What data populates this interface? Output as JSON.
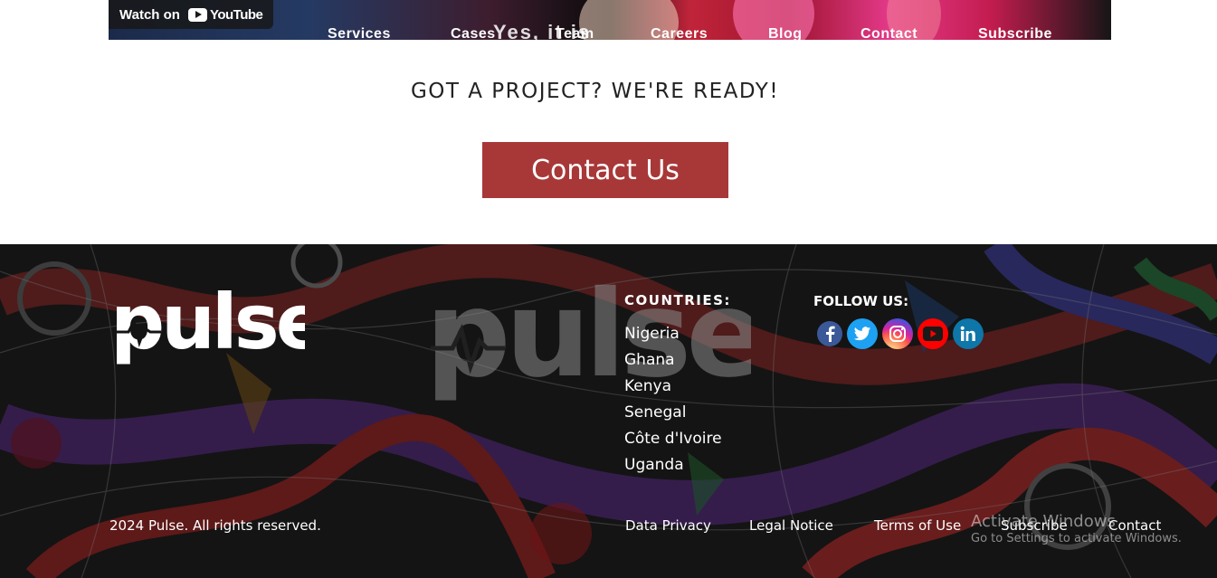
{
  "video": {
    "watch_label": "Watch on",
    "youtube_logo": "YouTube",
    "overlay_text": "Yes, it is",
    "nav": [
      "Services",
      "Cases",
      "Team",
      "Careers",
      "Blog",
      "Contact",
      "Subscribe"
    ]
  },
  "cta": {
    "heading": "GOT A PROJECT? WE'RE READY!",
    "button_label": "Contact Us",
    "button_color": "#a83838"
  },
  "footer": {
    "logo_text": "pulse",
    "countries_title": "COUNTRIES:",
    "countries": [
      "Nigeria",
      "Ghana",
      "Kenya",
      "Senegal",
      "Côte d'Ivoire",
      "Uganda"
    ],
    "follow_title": "FOLLOW US:",
    "socials": [
      {
        "name": "facebook",
        "icon": "facebook-icon",
        "color": "#3b5998"
      },
      {
        "name": "twitter",
        "icon": "twitter-icon",
        "color": "#1da1f2"
      },
      {
        "name": "instagram",
        "icon": "instagram-icon",
        "color": "#c13584"
      },
      {
        "name": "youtube",
        "icon": "youtube-icon",
        "color": "#ff0000"
      },
      {
        "name": "linkedin",
        "icon": "linkedin-icon",
        "color": "#0e76a8"
      }
    ],
    "copyright": "2024 Pulse. All rights reserved.",
    "links": [
      "Data Privacy",
      "Legal Notice",
      "Terms of Use",
      "Subscribe",
      "Contact"
    ]
  },
  "activation": {
    "title": "Activate Windows",
    "subtitle": "Go to Settings to activate Windows."
  }
}
